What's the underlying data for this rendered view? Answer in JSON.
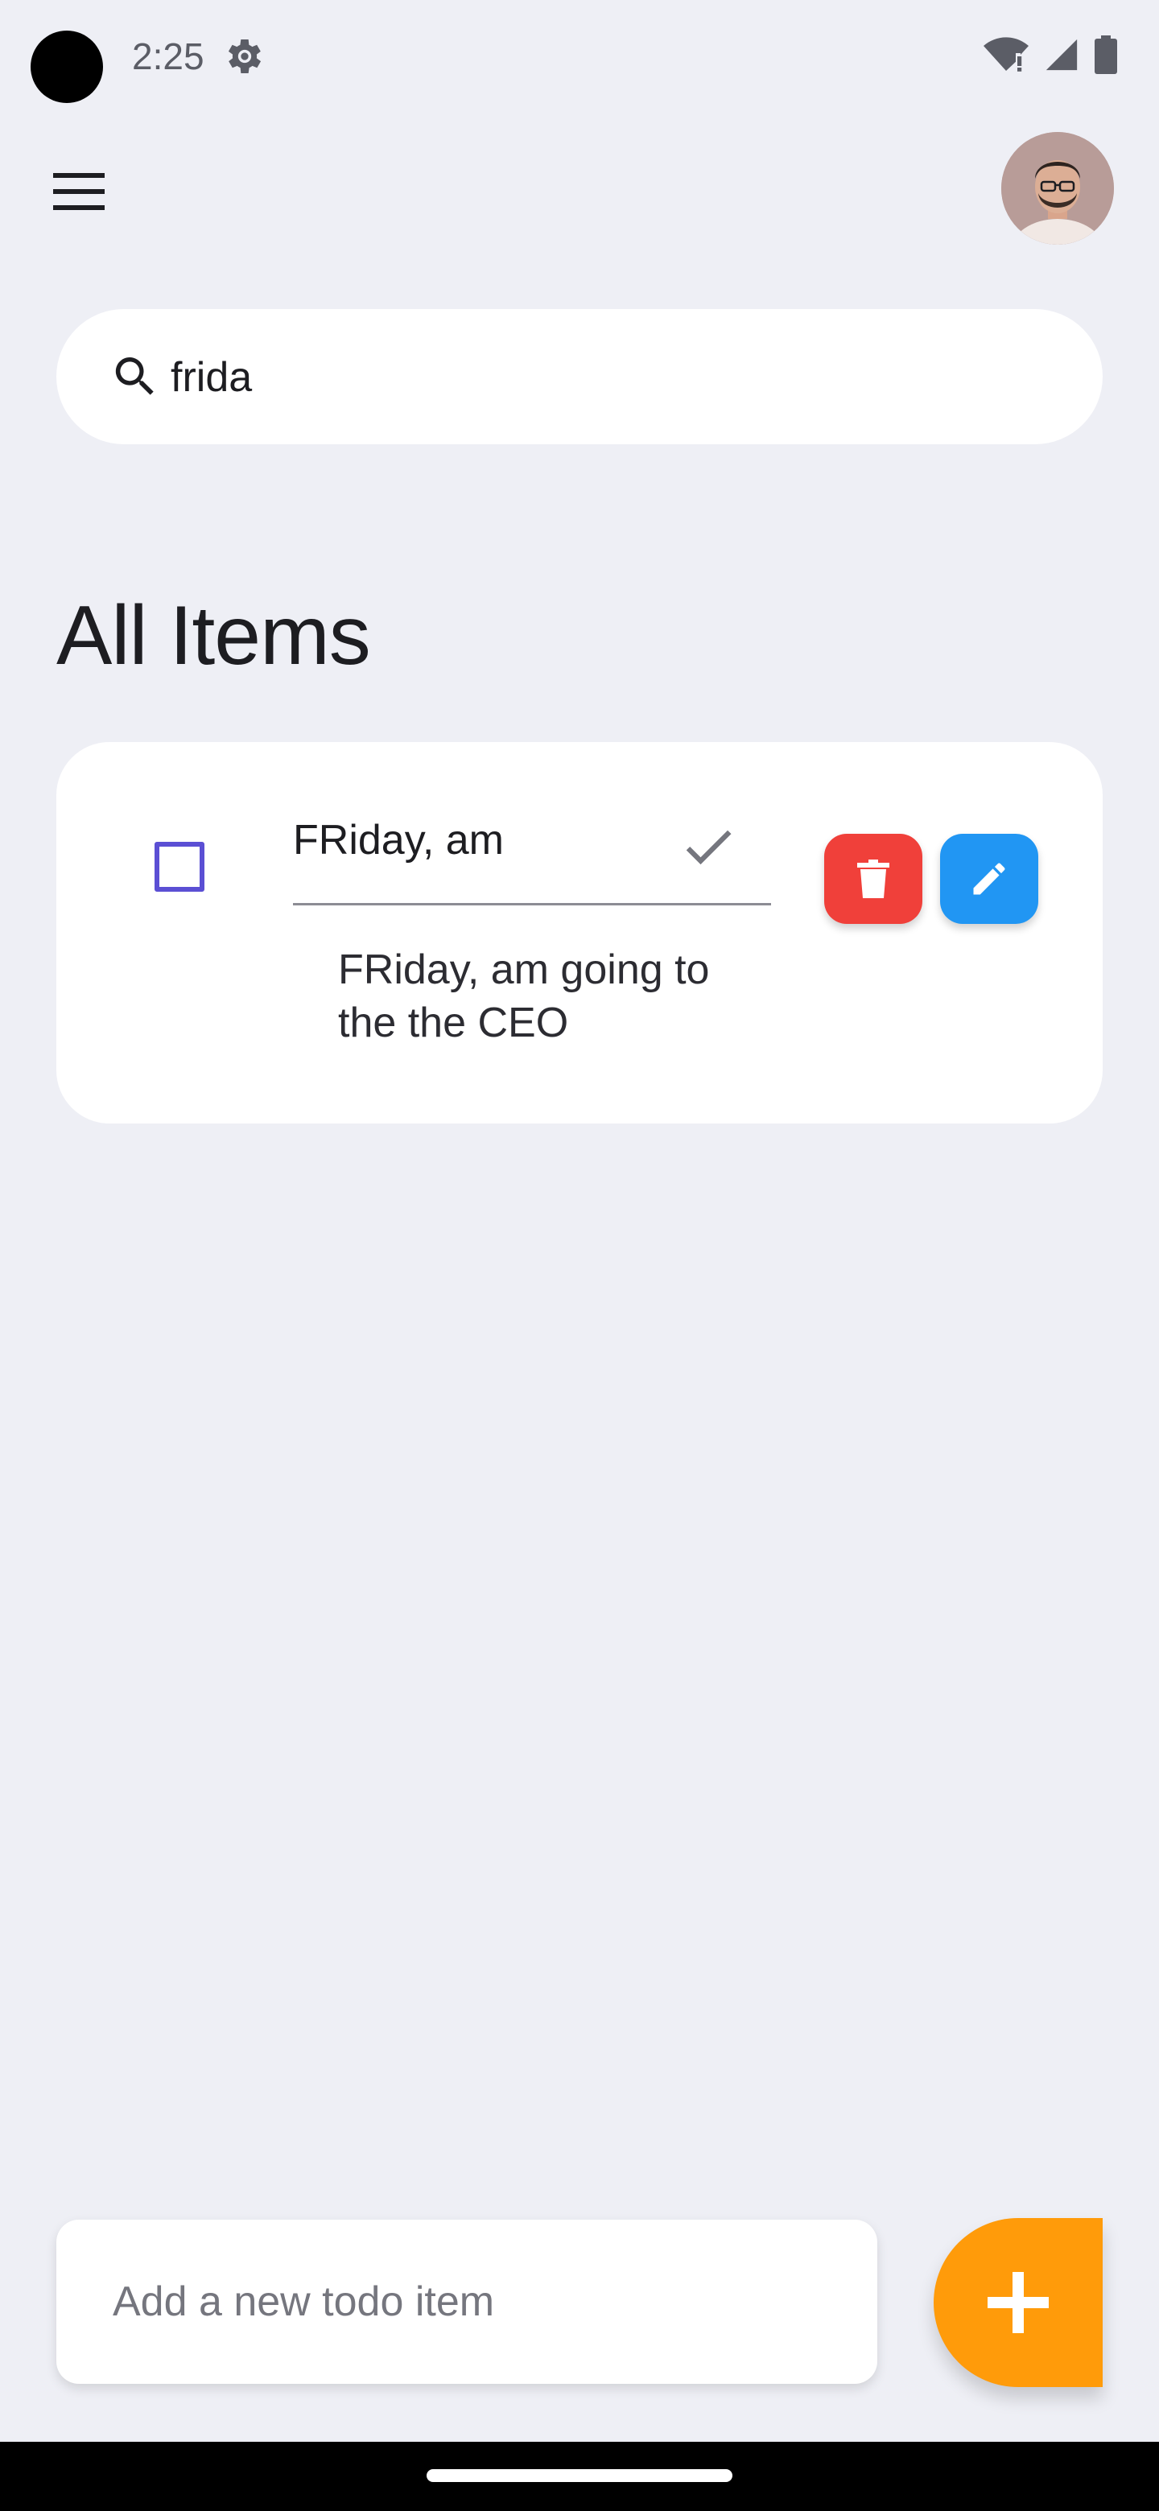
{
  "status_bar": {
    "time": "2:25"
  },
  "search": {
    "value": "frida",
    "icon": "search-icon"
  },
  "page": {
    "title": "All Items"
  },
  "todo_items": [
    {
      "edit_value": "FRiday, am",
      "text": "FRiday, am going to the the CEO",
      "checked": false
    }
  ],
  "new_todo": {
    "placeholder": "Add a new todo item"
  },
  "colors": {
    "background": "#eeeff5",
    "checkbox_accent": "#5b4fd4",
    "delete_button": "#f0403a",
    "edit_button": "#2196f3",
    "add_button": "#ff9b0a"
  }
}
